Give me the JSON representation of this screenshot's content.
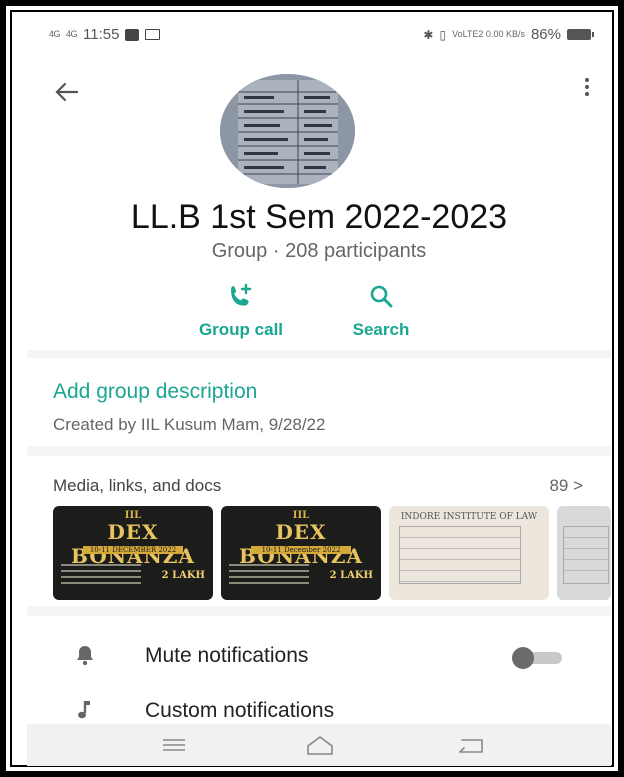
{
  "status_bar": {
    "signal_1": "4G",
    "signal_2": "4G",
    "time": "11:55",
    "right_small": "VoLTE2 0.00 KB/s",
    "battery": "86%"
  },
  "header": {
    "group_name": "LL.B 1st Sem 2022-2023",
    "group_subtitle": "Group · 208 participants",
    "actions": [
      {
        "label": "Group call",
        "icon": "add-call-icon"
      },
      {
        "label": "Search",
        "icon": "search-icon"
      }
    ]
  },
  "description": {
    "title": "Add group description",
    "created": "Created by IIL Kusum Mam, 9/28/22"
  },
  "media": {
    "title": "Media, links, and docs",
    "count": "89 >",
    "thumbnails": [
      {
        "type": "poster",
        "top": "IIL",
        "big": "DEX BONANZA",
        "date": "10-11 DECEMBER 2022",
        "amount": "2 LAKH"
      },
      {
        "type": "poster",
        "top": "IIL",
        "big": "DEX BONANZA",
        "date": "10-11 December 2022",
        "amount": "2 LAKH"
      },
      {
        "type": "document",
        "heading": "INDORE INSTITUTE OF LAW"
      },
      {
        "type": "document",
        "heading": ""
      }
    ]
  },
  "settings": {
    "mute_label": "Mute notifications",
    "mute_on": false,
    "custom_label": "Custom notifications"
  },
  "colors": {
    "accent": "#1aa690",
    "background": "#f4f5f5"
  }
}
